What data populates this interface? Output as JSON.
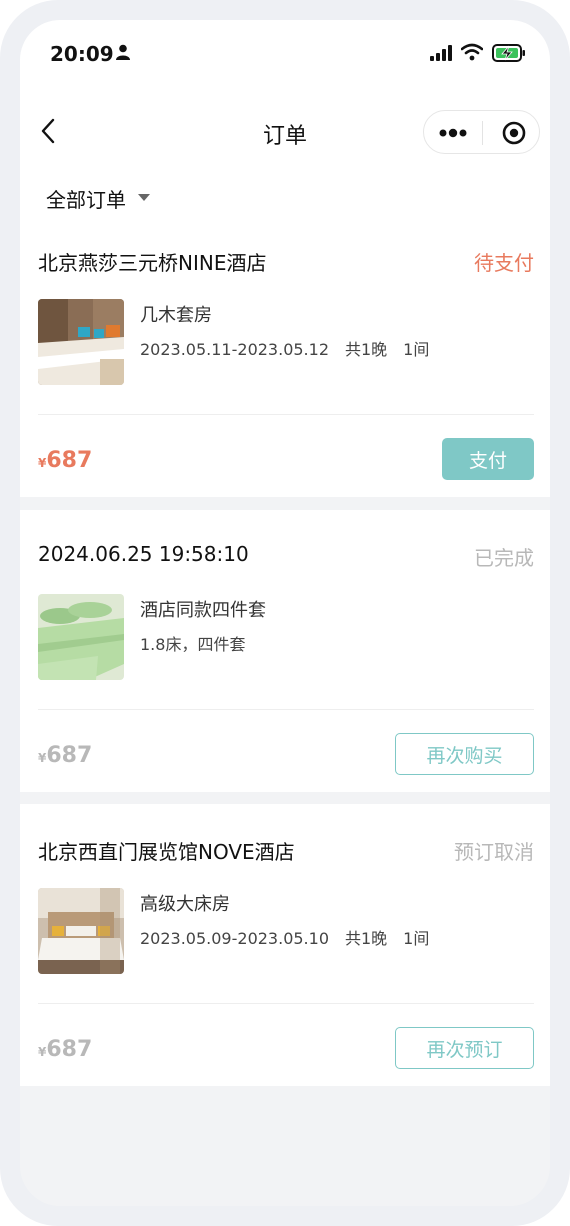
{
  "status_bar": {
    "time": "20:09"
  },
  "nav": {
    "title": "订单"
  },
  "filter": {
    "label": "全部订单"
  },
  "orders": [
    {
      "header": "北京燕莎三元桥NINE酒店",
      "status": "待支付",
      "status_color": "#e87a5e",
      "product_name": "几木套房",
      "product_desc": "2023.05.11-2023.05.12　共1晚　1间",
      "currency": "¥",
      "price": "687",
      "price_color": "#e87a5e",
      "action": "支付"
    },
    {
      "header": "2024.06.25 19:58:10",
      "status": "已完成",
      "status_color": "#b8b8b8",
      "product_name": "酒店同款四件套",
      "product_desc": "1.8床，四件套",
      "currency": "¥",
      "price": "687",
      "price_color": "#b8b8b8",
      "action": "再次购买"
    },
    {
      "header": "北京西直门展览馆NOVE酒店",
      "status": "预订取消",
      "status_color": "#b8b8b8",
      "product_name": "高级大床房",
      "product_desc": "2023.05.09-2023.05.10　共1晚　1间",
      "currency": "¥",
      "price": "687",
      "price_color": "#b8b8b8",
      "action": "再次预订"
    }
  ],
  "colors": {
    "accent": "#7fc8c6",
    "pending": "#e87a5e",
    "muted": "#b8b8b8"
  },
  "icons": [
    "person-icon",
    "signal-icon",
    "wifi-icon",
    "battery-charging-icon",
    "back-chevron-icon",
    "more-dots-icon",
    "target-icon",
    "dropdown-caret-icon"
  ]
}
